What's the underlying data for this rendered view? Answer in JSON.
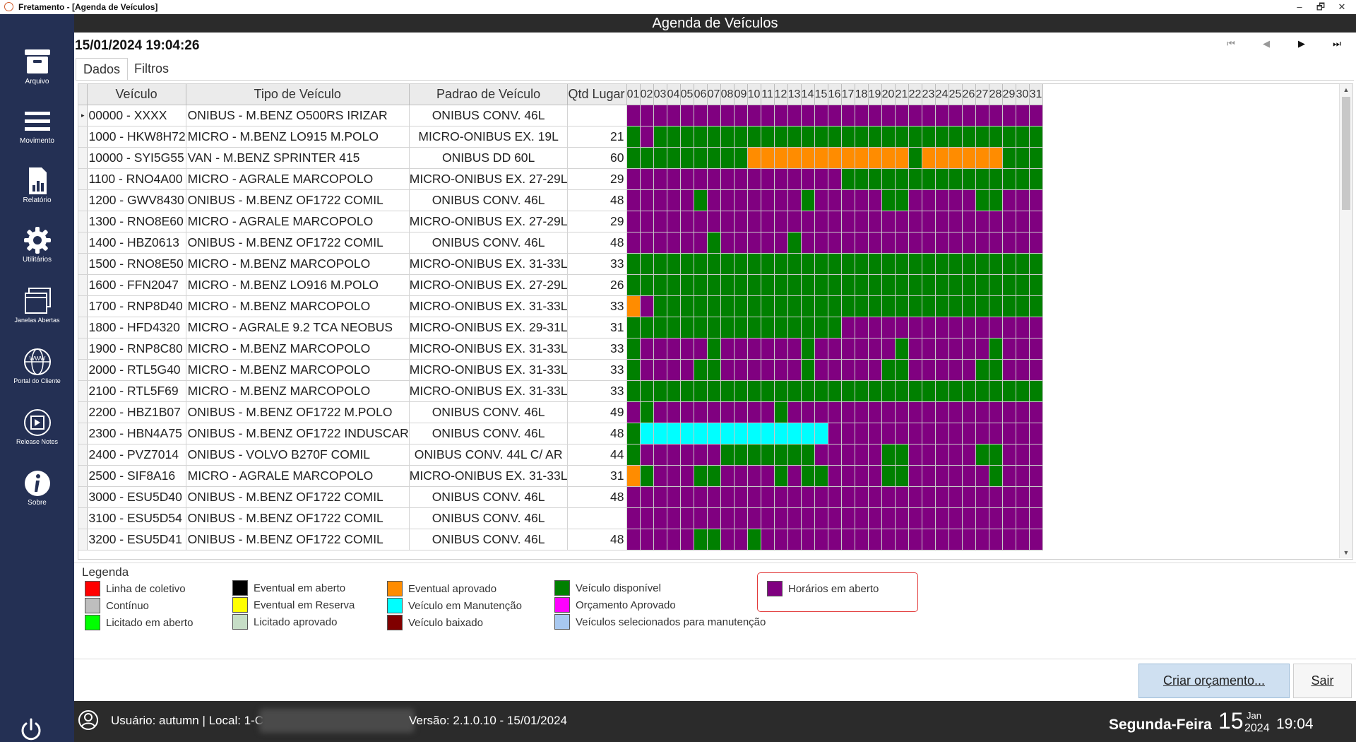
{
  "window": {
    "title": "Fretamento - [Agenda de Veículos]",
    "controls": [
      "–",
      "🗗",
      "✕"
    ]
  },
  "sidebar": {
    "items": [
      {
        "label": "Arquivo",
        "icon": "archive-icon"
      },
      {
        "label": "Movimento",
        "icon": "menu-icon"
      },
      {
        "label": "Relatório",
        "icon": "report-icon"
      },
      {
        "label": "Utilitários",
        "icon": "gear-icon"
      },
      {
        "label": "Janelas Abertas",
        "icon": "windows-icon"
      },
      {
        "label": "Portal do Cliente",
        "icon": "globe-icon"
      },
      {
        "label": "Release Notes",
        "icon": "release-notes-icon"
      },
      {
        "label": "Sobre",
        "icon": "info-icon"
      }
    ],
    "power_icon": "power-icon"
  },
  "header": {
    "title": "Agenda de Veículos",
    "datetime": "15/01/2024 19:04:26"
  },
  "nav": {
    "first": "⏮",
    "prev": "◀",
    "next": "▶",
    "last": "⏭"
  },
  "tabs": [
    {
      "label": "Dados",
      "active": true
    },
    {
      "label": "Filtros",
      "active": false
    }
  ],
  "grid": {
    "columns": [
      "Veículo",
      "Tipo de Veículo",
      "Padrao de Veículo",
      "Qtd Lugar"
    ],
    "days": [
      "01",
      "02",
      "03",
      "04",
      "05",
      "06",
      "07",
      "08",
      "09",
      "10",
      "11",
      "12",
      "13",
      "14",
      "15",
      "16",
      "17",
      "18",
      "19",
      "20",
      "21",
      "22",
      "23",
      "24",
      "25",
      "26",
      "27",
      "28",
      "29",
      "30",
      "31"
    ],
    "colors": {
      "P": "#800080",
      "G": "#008000",
      "O": "#FF8C00",
      "C": "#00FFFF"
    },
    "rows": [
      {
        "veiculo": "00000 - XXXX",
        "tipo": "ONIBUS - M.BENZ O500RS IRIZAR",
        "padrao": "ONIBUS CONV. 46L",
        "lugares": "",
        "days": "PPPPPPPPPPPPPPPPPPPPPPPPPPPPPPP"
      },
      {
        "veiculo": "1000 - HKW8H72",
        "tipo": "MICRO - M.BENZ LO915 M.POLO",
        "padrao": "MICRO-ONIBUS EX. 19L",
        "lugares": "21",
        "days": "GPGGGGGGGGGGGGGGGGGGGGGGGGGGGGG"
      },
      {
        "veiculo": "10000 - SYI5G55",
        "tipo": "VAN - M.BENZ SPRINTER 415",
        "padrao": "ONIBUS DD 60L",
        "lugares": "60",
        "days": "GGGGGGGGGOOOOOOOOOOOOGOOOOOOGGG"
      },
      {
        "veiculo": "1100 - RNO4A00",
        "tipo": "MICRO - AGRALE MARCOPOLO",
        "padrao": "MICRO-ONIBUS EX. 27-29L",
        "lugares": "29",
        "days": "PPPPPPPPPPPPPPPPGGGGGGGGGGGGGGG"
      },
      {
        "veiculo": "1200 - GWV8430",
        "tipo": "ONIBUS - M.BENZ OF1722 COMIL",
        "padrao": "ONIBUS CONV. 46L",
        "lugares": "48",
        "days": "PPPPPGPPPPPPPGPPPPPGGPPPPPGGPPP"
      },
      {
        "veiculo": "1300 - RNO8E60",
        "tipo": "MICRO - AGRALE MARCOPOLO",
        "padrao": "MICRO-ONIBUS EX. 27-29L",
        "lugares": "29",
        "days": "PPPPPPPPPPPPPPPPPPPPPPPPPPPPPPP"
      },
      {
        "veiculo": "1400 - HBZ0613",
        "tipo": "ONIBUS - M.BENZ OF1722 COMIL",
        "padrao": "ONIBUS CONV. 46L",
        "lugares": "48",
        "days": "PPPPPPGPPPPPGPPPPPPPPPPPPPPPPPP"
      },
      {
        "veiculo": "1500 - RNO8E50",
        "tipo": "MICRO - M.BENZ MARCOPOLO",
        "padrao": "MICRO-ONIBUS EX. 31-33L",
        "lugares": "33",
        "days": "GGGGGGGGGGGGGGGGGGGGGGGGGGGGGGG"
      },
      {
        "veiculo": "1600 - FFN2047",
        "tipo": "MICRO - M.BENZ LO916 M.POLO",
        "padrao": "MICRO-ONIBUS EX. 27-29L",
        "lugares": "26",
        "days": "GGGGGGGGGGGGGGGGGGGGGGGGGGGGGGG"
      },
      {
        "veiculo": "1700 - RNP8D40",
        "tipo": "MICRO - M.BENZ MARCOPOLO",
        "padrao": "MICRO-ONIBUS EX. 31-33L",
        "lugares": "33",
        "days": "OPGGGGGGGGGGGGGGGGGGGGGGGGGGGGG"
      },
      {
        "veiculo": "1800 - HFD4320",
        "tipo": "MICRO - AGRALE 9.2 TCA NEOBUS",
        "padrao": "MICRO-ONIBUS EX. 29-31L",
        "lugares": "31",
        "days": "GGGGGGGGGGGGGGGGPPPPPPPPPPPPPPP"
      },
      {
        "veiculo": "1900 - RNP8C80",
        "tipo": "MICRO - M.BENZ MARCOPOLO",
        "padrao": "MICRO-ONIBUS EX. 31-33L",
        "lugares": "33",
        "days": "GPPPPPGPPPPPPGPPPPPPGPPPPPPGPPP"
      },
      {
        "veiculo": "2000 - RTL5G40",
        "tipo": "MICRO - M.BENZ MARCOPOLO",
        "padrao": "MICRO-ONIBUS EX. 31-33L",
        "lugares": "33",
        "days": "GPPPPGGPPPPPPGPPPPPGGPPPPPGGPPP"
      },
      {
        "veiculo": "2100 - RTL5F69",
        "tipo": "MICRO - M.BENZ MARCOPOLO",
        "padrao": "MICRO-ONIBUS EX. 31-33L",
        "lugares": "33",
        "days": "GGGGGGGGGGGGGGGGGGGGGGGGGGGGGGG"
      },
      {
        "veiculo": "2200 - HBZ1B07",
        "tipo": "ONIBUS - M.BENZ OF1722 M.POLO",
        "padrao": "ONIBUS CONV. 46L",
        "lugares": "49",
        "days": "PGPPPPPPPPPGPPPPPPPPPPPPPPPPPPP"
      },
      {
        "veiculo": "2300 - HBN4A75",
        "tipo": "ONIBUS - M.BENZ OF1722 INDUSCAR",
        "padrao": "ONIBUS CONV. 46L",
        "lugares": "48",
        "days": "GCCCCCCCCCCCCCCPPPPPPPPPPPPPPPP"
      },
      {
        "veiculo": "2400 - PVZ7014",
        "tipo": "ONIBUS - VOLVO B270F COMIL",
        "padrao": "ONIBUS CONV. 44L C/ AR",
        "lugares": "44",
        "days": "GPPPPPPGGGGGGGPPPPPGGPPPPPGGPPP"
      },
      {
        "veiculo": "2500 - SIF8A16",
        "tipo": "MICRO - AGRALE MARCOPOLO",
        "padrao": "MICRO-ONIBUS EX. 31-33L",
        "lugares": "31",
        "days": "OGPPPGGPPPPGPGGPPPPGGPPPPPPGPPP"
      },
      {
        "veiculo": "3000 - ESU5D40",
        "tipo": "ONIBUS - M.BENZ OF1722 COMIL",
        "padrao": "ONIBUS CONV. 46L",
        "lugares": "48",
        "days": "PPPPPPPPPPPPPPPPPPPPPPPPPPPPPPP"
      },
      {
        "veiculo": "3100 - ESU5D54",
        "tipo": "ONIBUS - M.BENZ OF1722 COMIL",
        "padrao": "ONIBUS CONV. 46L",
        "lugares": "",
        "days": "PPPPPPPPPPPPPPPPPPPPPPPPPPPPPPP"
      },
      {
        "veiculo": "3200 - ESU5D41",
        "tipo": "ONIBUS - M.BENZ OF1722 COMIL",
        "padrao": "ONIBUS CONV. 46L",
        "lugares": "48",
        "days": "PPPPPGGPPGPPPPPPPPPPPPPPPPPPPPP"
      }
    ]
  },
  "legend": {
    "title": "Legenda",
    "items": [
      {
        "label": "Linha de coletivo",
        "color": "#FF0000"
      },
      {
        "label": "Contínuo",
        "color": "#BEBEBE"
      },
      {
        "label": "Licitado em aberto",
        "color": "#00FF00"
      },
      {
        "label": "Eventual em aberto",
        "color": "#000000"
      },
      {
        "label": "Eventual em Reserva",
        "color": "#FFFF00"
      },
      {
        "label": "Licitado aprovado",
        "color": "#C6DDC6"
      },
      {
        "label": "Eventual aprovado",
        "color": "#FF8C00"
      },
      {
        "label": "Veículo em Manutenção",
        "color": "#00FFFF"
      },
      {
        "label": "Veículo baixado",
        "color": "#800000"
      },
      {
        "label": "Veículo disponível",
        "color": "#008000"
      },
      {
        "label": "Orçamento Aprovado",
        "color": "#FF00FF"
      },
      {
        "label": "Veículos selecionados para manutenção",
        "color": "#A8C8F0"
      },
      {
        "label": "Horários em aberto",
        "color": "#800080"
      }
    ]
  },
  "buttons": {
    "create_quote": "Criar orçamento...",
    "exit": "Sair"
  },
  "status": {
    "user_text": "Usuário: autumn | Local: 1-C",
    "version": "Versão: 2.1.0.10 - 15/01/2024",
    "weekday": "Segunda-Feira",
    "day": "15",
    "month": "Jan",
    "year": "2024",
    "time": "19:04"
  }
}
